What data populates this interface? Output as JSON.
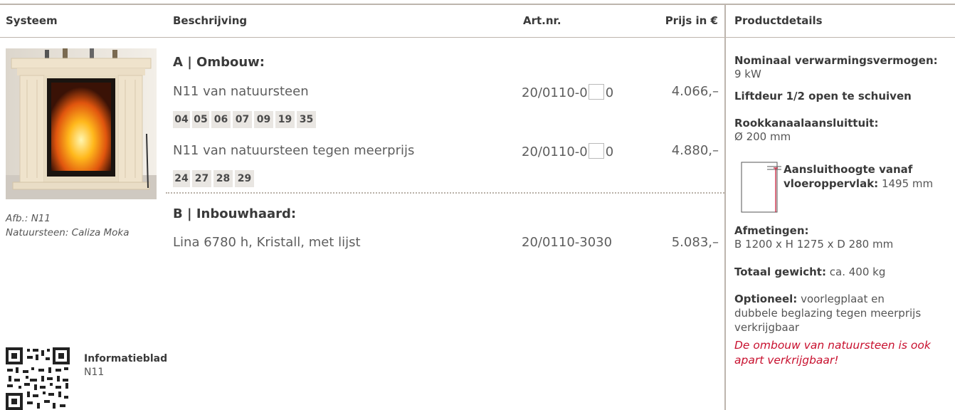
{
  "header": {
    "col1": "Systeem",
    "col2": "Beschrijving",
    "col3": "Art.nr.",
    "col4": "Prijs in €",
    "col5": "Productdetails"
  },
  "caption": {
    "line1": "Afb.: N11",
    "line2": "Natuursteen: Caliza Moka"
  },
  "info": {
    "title": "Informatieblad",
    "subtitle": "N11"
  },
  "section_a": {
    "title": "A | Ombouw:",
    "row1": {
      "desc": "N11 van natuursteen",
      "art_prefix": "20/0110-0",
      "art_suffix": "0",
      "price": "4.066,–"
    },
    "tags1": [
      "04",
      "05",
      "06",
      "07",
      "09",
      "19",
      "35"
    ],
    "row2": {
      "desc": "N11 van natuursteen tegen meerprijs",
      "art_prefix": "20/0110-0",
      "art_suffix": "0",
      "price": "4.880,–"
    },
    "tags2": [
      "24",
      "27",
      "28",
      "29"
    ]
  },
  "section_b": {
    "title": "B | Inbouwhaard:",
    "row1": {
      "desc": "Lina 6780 h, Kristall, met lijst",
      "art": "20/0110-3030",
      "price": "5.083,–"
    }
  },
  "details": {
    "power_label": "Nominaal verwarmingsvermogen:",
    "power_value": "9 kW",
    "door": "Liftdeur 1/2 open te schuiven",
    "flue_label": "Rookkanaalaansluittuit:",
    "flue_value": "Ø 200 mm",
    "height_label1": "Aansluithoogte vanaf",
    "height_label2": "vloeroppervlak:",
    "height_value": "1495 mm",
    "dims_label": "Afmetingen:",
    "dims_value": "B 1200 x H 1275 x D 280 mm",
    "weight_label": "Totaal gewicht:",
    "weight_value": "ca. 400 kg",
    "optional_label": "Optioneel:",
    "optional_line1": "voorlegplaat en",
    "optional_line2": "dubbele beglazing tegen meerprijs",
    "optional_line3": "verkrijgbaar",
    "note_line1": "De ombouw van natuursteen is ook",
    "note_line2": "apart verkrijgbaar!"
  },
  "colors": {
    "accent_red": "#c8102e",
    "rule": "#bdb5ad",
    "tag_bg": "#e9e6e2"
  }
}
